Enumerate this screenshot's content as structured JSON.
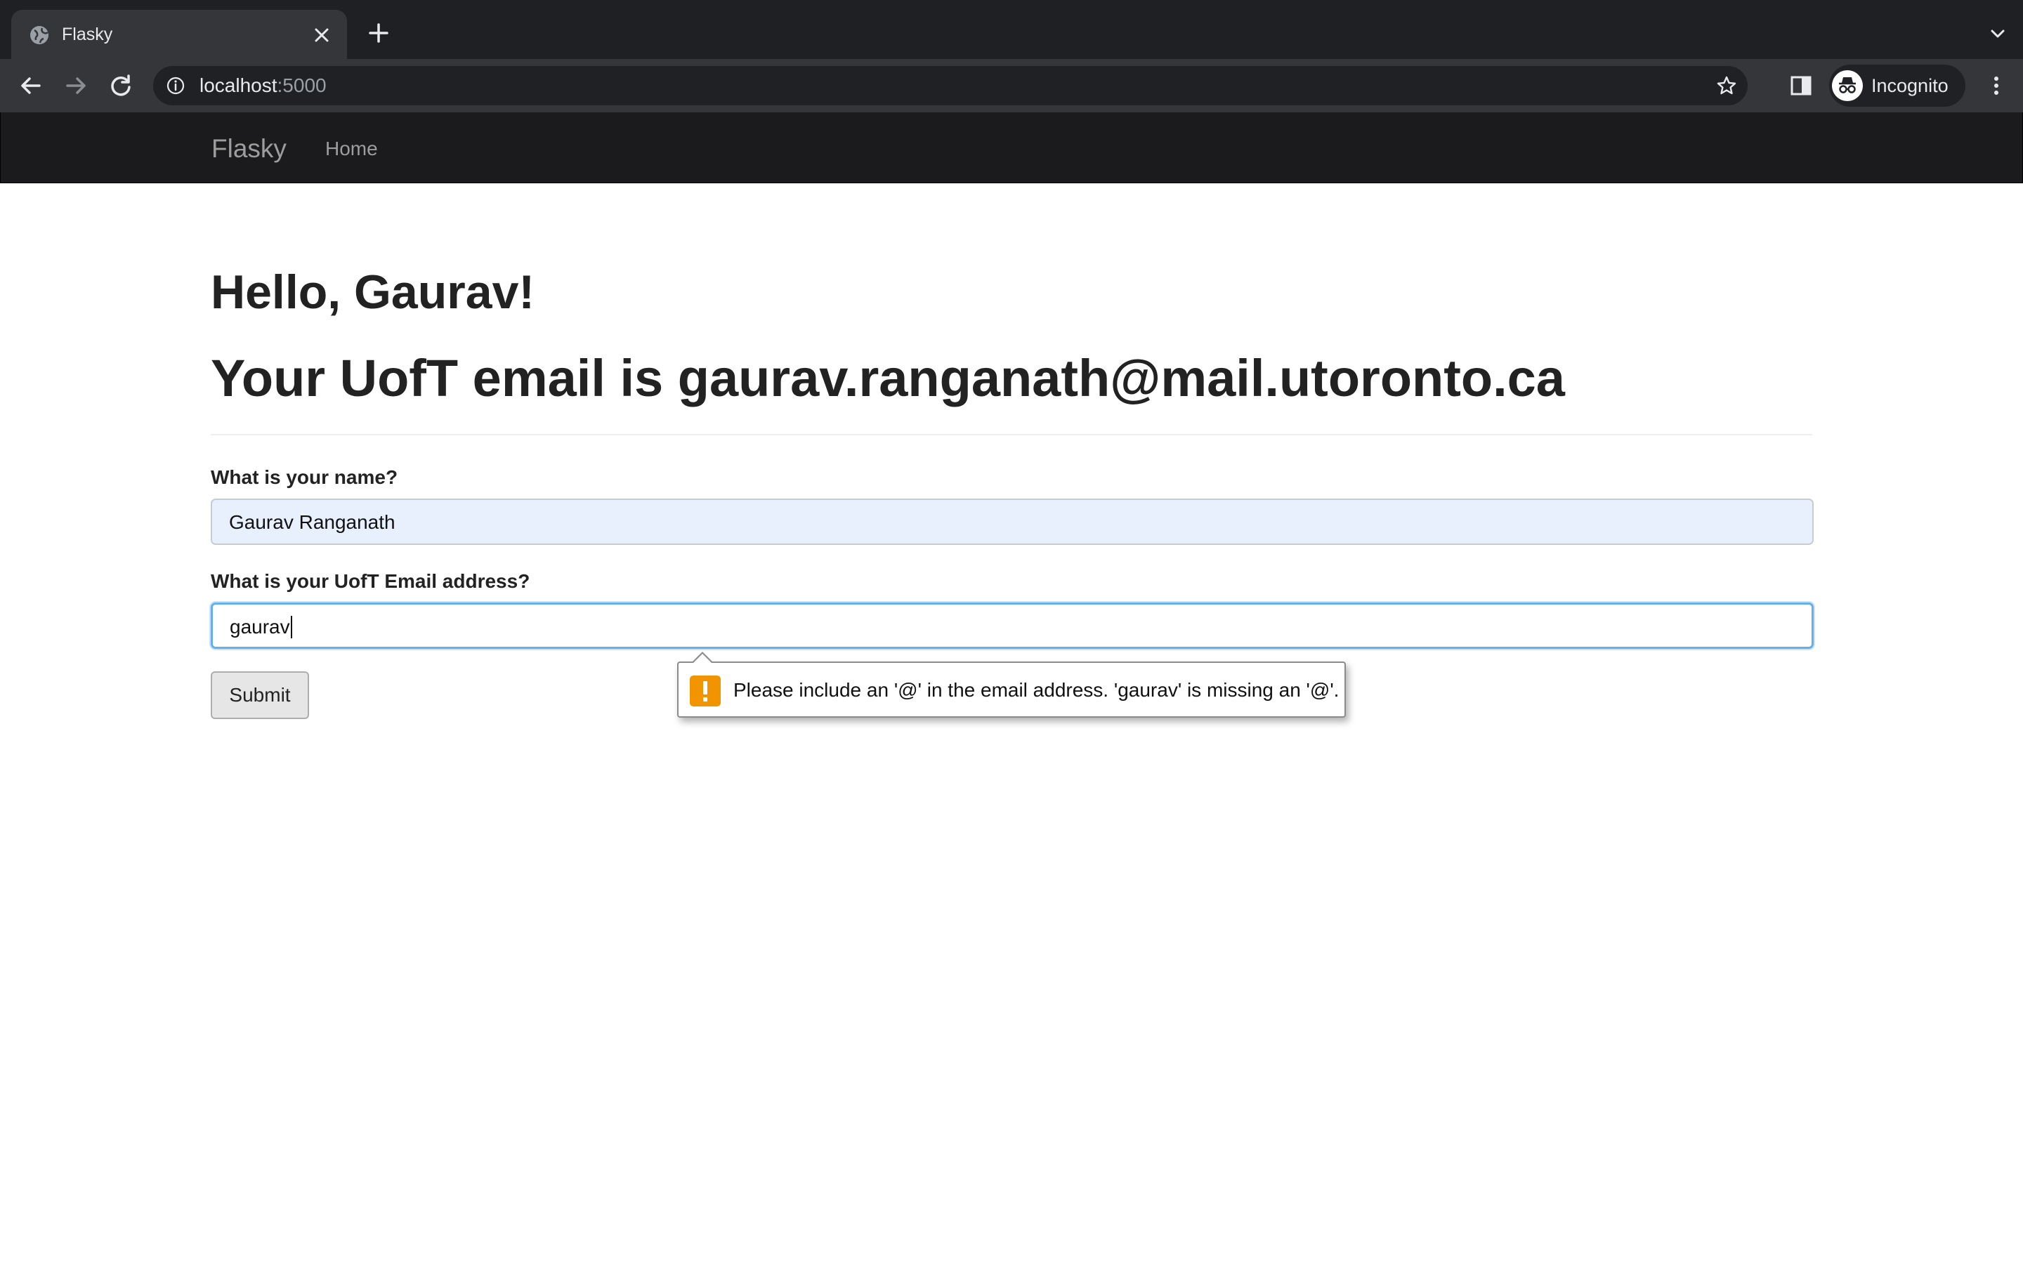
{
  "browser": {
    "tab_title": "Flasky",
    "url_host": "localhost",
    "url_port": ":5000",
    "incognito_label": "Incognito"
  },
  "navbar": {
    "brand": "Flasky",
    "home_link": "Home"
  },
  "main": {
    "greeting": "Hello, Gaurav!",
    "email_line": "Your UofT email is gaurav.ranganath@mail.utoronto.ca"
  },
  "form": {
    "name_label": "What is your name?",
    "name_value": "Gaurav Ranganath",
    "email_label": "What is your UofT Email address?",
    "email_value": "gaurav",
    "submit_label": "Submit"
  },
  "validation": {
    "message": "Please include an '@' in the email address. 'gaurav' is missing an '@'."
  },
  "colors": {
    "tab_strip": "#1f2023",
    "toolbar": "#35363a",
    "navbar": "#1b1b1d",
    "autofill_bg": "#e8f0fe",
    "focus_border": "#66afe9",
    "warning": "#f29400"
  },
  "icons": [
    "globe-icon",
    "close-icon",
    "plus-icon",
    "chevron-down-icon",
    "back-arrow-icon",
    "forward-arrow-icon",
    "reload-icon",
    "info-icon",
    "star-icon",
    "side-panel-icon",
    "incognito-icon",
    "more-vert-icon",
    "warning-icon"
  ]
}
